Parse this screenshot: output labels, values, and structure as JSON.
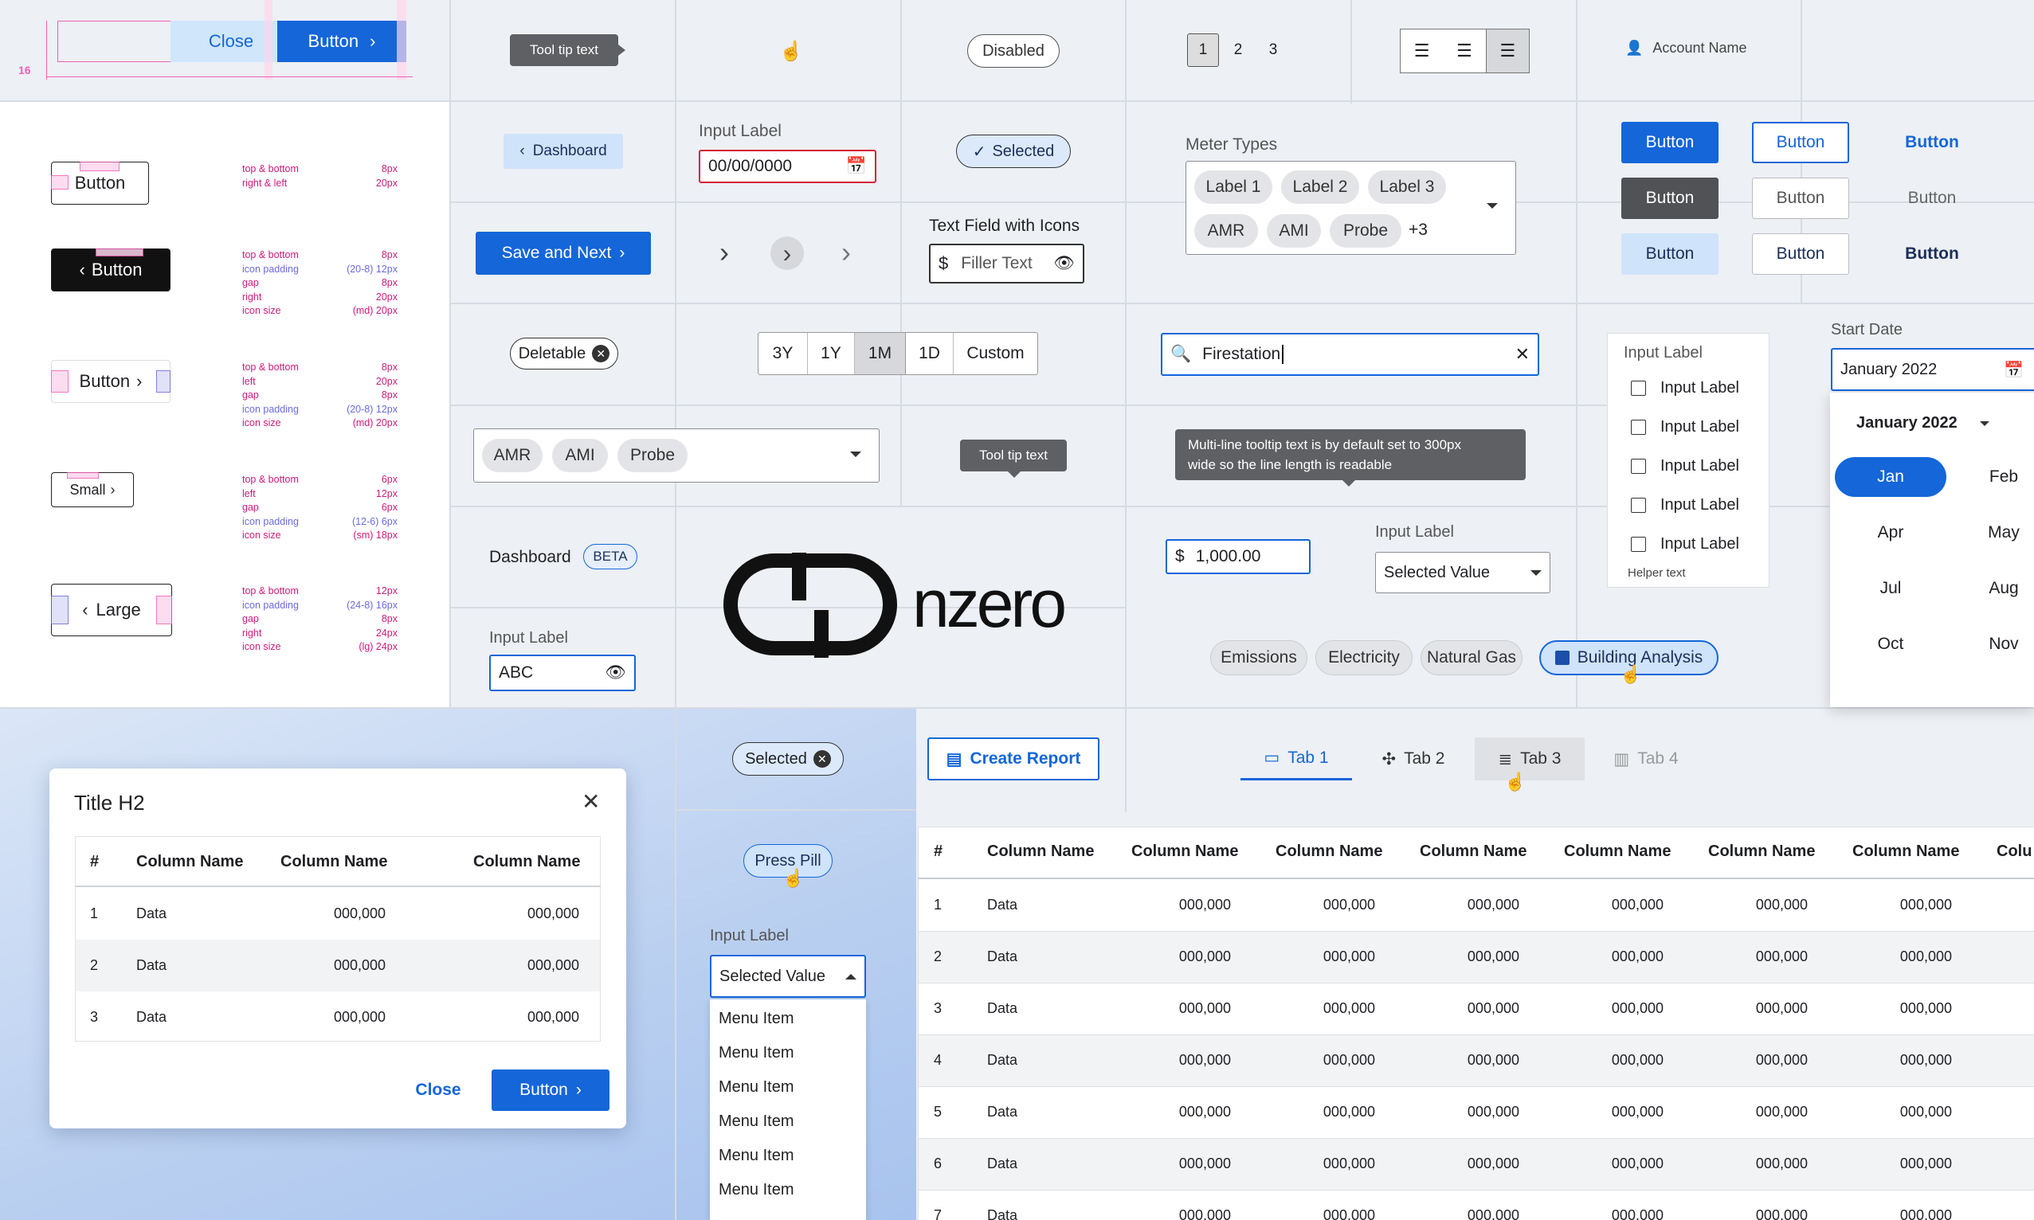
{
  "top_bar": {
    "anatomy": {
      "close_label": "Close",
      "button_label": "Button",
      "margin_label": "16"
    },
    "tooltip": "Tool tip text",
    "disabled": "Disabled",
    "pagination": [
      "1",
      "2",
      "3"
    ],
    "account": "Account Name"
  },
  "spec_panel": {
    "rows": [
      {
        "demo": "Button",
        "specs": [
          [
            "top & bottom",
            "8px"
          ],
          [
            "right & left",
            "20px"
          ]
        ]
      },
      {
        "demo": "Button",
        "specs": [
          [
            "top & bottom",
            "8px"
          ],
          [
            "icon padding",
            "(20-8) 12px"
          ],
          [
            "gap",
            "8px"
          ],
          [
            "right",
            "20px"
          ],
          [
            "icon size",
            "(md) 20px"
          ]
        ]
      },
      {
        "demo": "Button",
        "specs": [
          [
            "top & bottom",
            "8px"
          ],
          [
            "left",
            "20px"
          ],
          [
            "gap",
            "8px"
          ],
          [
            "icon padding",
            "(20-8) 12px"
          ],
          [
            "icon size",
            "(md) 20px"
          ]
        ]
      },
      {
        "demo": "Small",
        "specs": [
          [
            "top & bottom",
            "6px"
          ],
          [
            "left",
            "12px"
          ],
          [
            "gap",
            "6px"
          ],
          [
            "icon padding",
            "(12-6) 6px"
          ],
          [
            "icon size",
            "(sm) 18px"
          ]
        ]
      },
      {
        "demo": "Large",
        "specs": [
          [
            "top & bottom",
            "12px"
          ],
          [
            "icon padding",
            "(24-8) 16px"
          ],
          [
            "gap",
            "8px"
          ],
          [
            "right",
            "24px"
          ],
          [
            "icon size",
            "(lg) 24px"
          ]
        ]
      }
    ]
  },
  "components": {
    "dashboard_back": "Dashboard",
    "date_input": {
      "label": "Input Label",
      "value": "00/00/0000"
    },
    "selected_chip": "Selected",
    "meter": {
      "label": "Meter Types",
      "chips": [
        "Label 1",
        "Label 2",
        "Label 3",
        "AMR",
        "AMI",
        "Probe"
      ],
      "more": "+3"
    },
    "save_next": "Save and Next",
    "text_field_icons": {
      "label": "Text Field with Icons",
      "value": "Filler Text"
    },
    "deletable": "Deletable",
    "ranges": [
      "3Y",
      "1Y",
      "1M",
      "1D",
      "Custom"
    ],
    "search_value": "Firestation",
    "checkbox_group": {
      "label": "Input Label",
      "items": [
        "Input Label",
        "Input Label",
        "Input Label",
        "Input Label",
        "Input Label"
      ],
      "helper": "Helper text"
    },
    "start_date": {
      "label": "Start Date",
      "value": "January 2022",
      "header": "January 2022",
      "months": [
        "Jan",
        "Feb",
        "Apr",
        "May",
        "Jul",
        "Aug",
        "Oct",
        "Nov"
      ]
    },
    "multi_chips": [
      "AMR",
      "AMI",
      "Probe"
    ],
    "tooltip2": "Tool tip text",
    "multiline_tooltip": [
      "Multi-line tooltip text is by default set to 300px",
      "wide so the line length is readable"
    ],
    "dashboard_beta": {
      "title": "Dashboard",
      "badge": "BETA"
    },
    "amount": "1,000.00",
    "select": {
      "label": "Input Label",
      "value": "Selected Value"
    },
    "logo": "nzero",
    "password": {
      "label": "Input Label",
      "value": "ABC"
    },
    "filter_pills": [
      "Emissions",
      "Electricity",
      "Natural Gas",
      "Building Analysis"
    ],
    "button_grid": [
      "Button",
      "Button",
      "Button",
      "Button",
      "Button",
      "Button",
      "Button",
      "Button",
      "Button"
    ]
  },
  "modal": {
    "title": "Title H2",
    "headers": [
      "#",
      "Column Name",
      "Column Name",
      "Column Name"
    ],
    "rows": [
      [
        "1",
        "Data",
        "000,000",
        "000,000"
      ],
      [
        "2",
        "Data",
        "000,000",
        "000,000"
      ],
      [
        "3",
        "Data",
        "000,000",
        "000,000"
      ]
    ],
    "close": "Close",
    "button": "Button"
  },
  "bottom": {
    "selected": "Selected",
    "press_pill": "Press Pill",
    "create_report": "Create Report",
    "tabs": [
      "Tab 1",
      "Tab 2",
      "Tab 3",
      "Tab 4"
    ],
    "dropdown": {
      "label": "Input Label",
      "value": "Selected Value",
      "items": [
        "Menu Item",
        "Menu Item",
        "Menu Item",
        "Menu Item",
        "Menu Item",
        "Menu Item"
      ]
    }
  },
  "big_table": {
    "headers": [
      "#",
      "Column Name",
      "Column Name",
      "Column Name",
      "Column Name",
      "Column Name",
      "Column Name",
      "Column Name",
      "Colu"
    ],
    "rows": [
      [
        "1",
        "Data",
        "000,000",
        "000,000",
        "000,000",
        "000,000",
        "000,000",
        "000,000"
      ],
      [
        "2",
        "Data",
        "000,000",
        "000,000",
        "000,000",
        "000,000",
        "000,000",
        "000,000"
      ],
      [
        "3",
        "Data",
        "000,000",
        "000,000",
        "000,000",
        "000,000",
        "000,000",
        "000,000"
      ],
      [
        "4",
        "Data",
        "000,000",
        "000,000",
        "000,000",
        "000,000",
        "000,000",
        "000,000"
      ],
      [
        "5",
        "Data",
        "000,000",
        "000,000",
        "000,000",
        "000,000",
        "000,000",
        "000,000"
      ],
      [
        "6",
        "Data",
        "000,000",
        "000,000",
        "000,000",
        "000,000",
        "000,000",
        "000,000"
      ],
      [
        "7",
        "Data",
        "000,000",
        "000,000",
        "000,000",
        "000,000",
        "000,000",
        "000,000"
      ]
    ]
  },
  "colors": {
    "primary": "#1466d9",
    "chip": "#e3e4e7",
    "tooltip": "#5f6063",
    "error": "#d5203a",
    "spec": "#cc1b7a"
  }
}
